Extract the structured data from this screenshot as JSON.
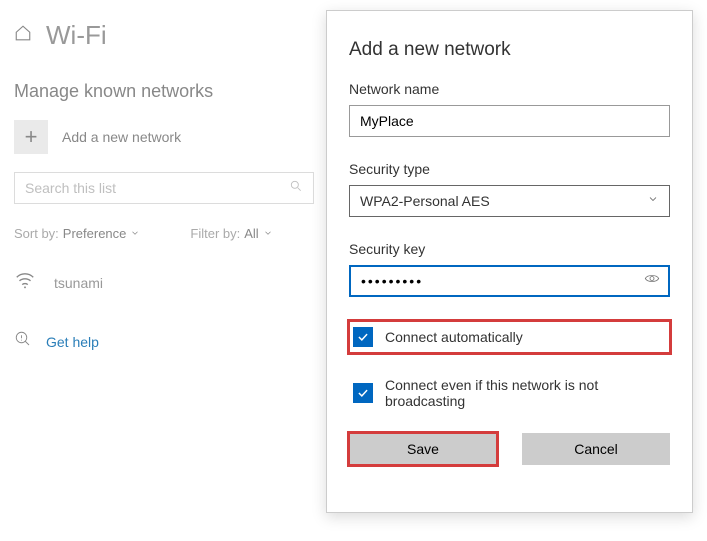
{
  "page": {
    "title": "Wi-Fi",
    "subtitle": "Manage known networks"
  },
  "add_network_label": "Add a new network",
  "search": {
    "placeholder": "Search this list"
  },
  "filters": {
    "sort_label": "Sort by:",
    "sort_value": "Preference",
    "filter_label": "Filter by:",
    "filter_value": "All"
  },
  "networks": [
    {
      "name": "tsunami"
    }
  ],
  "help_label": "Get help",
  "dialog": {
    "title": "Add a new network",
    "network_name_label": "Network name",
    "network_name_value": "MyPlace",
    "security_type_label": "Security type",
    "security_type_value": "WPA2-Personal AES",
    "security_key_label": "Security key",
    "security_key_value": "•••••••••",
    "connect_auto_label": "Connect automatically",
    "connect_auto_checked": true,
    "connect_hidden_label": "Connect even if this network is not broadcasting",
    "connect_hidden_checked": true,
    "save_label": "Save",
    "cancel_label": "Cancel"
  }
}
